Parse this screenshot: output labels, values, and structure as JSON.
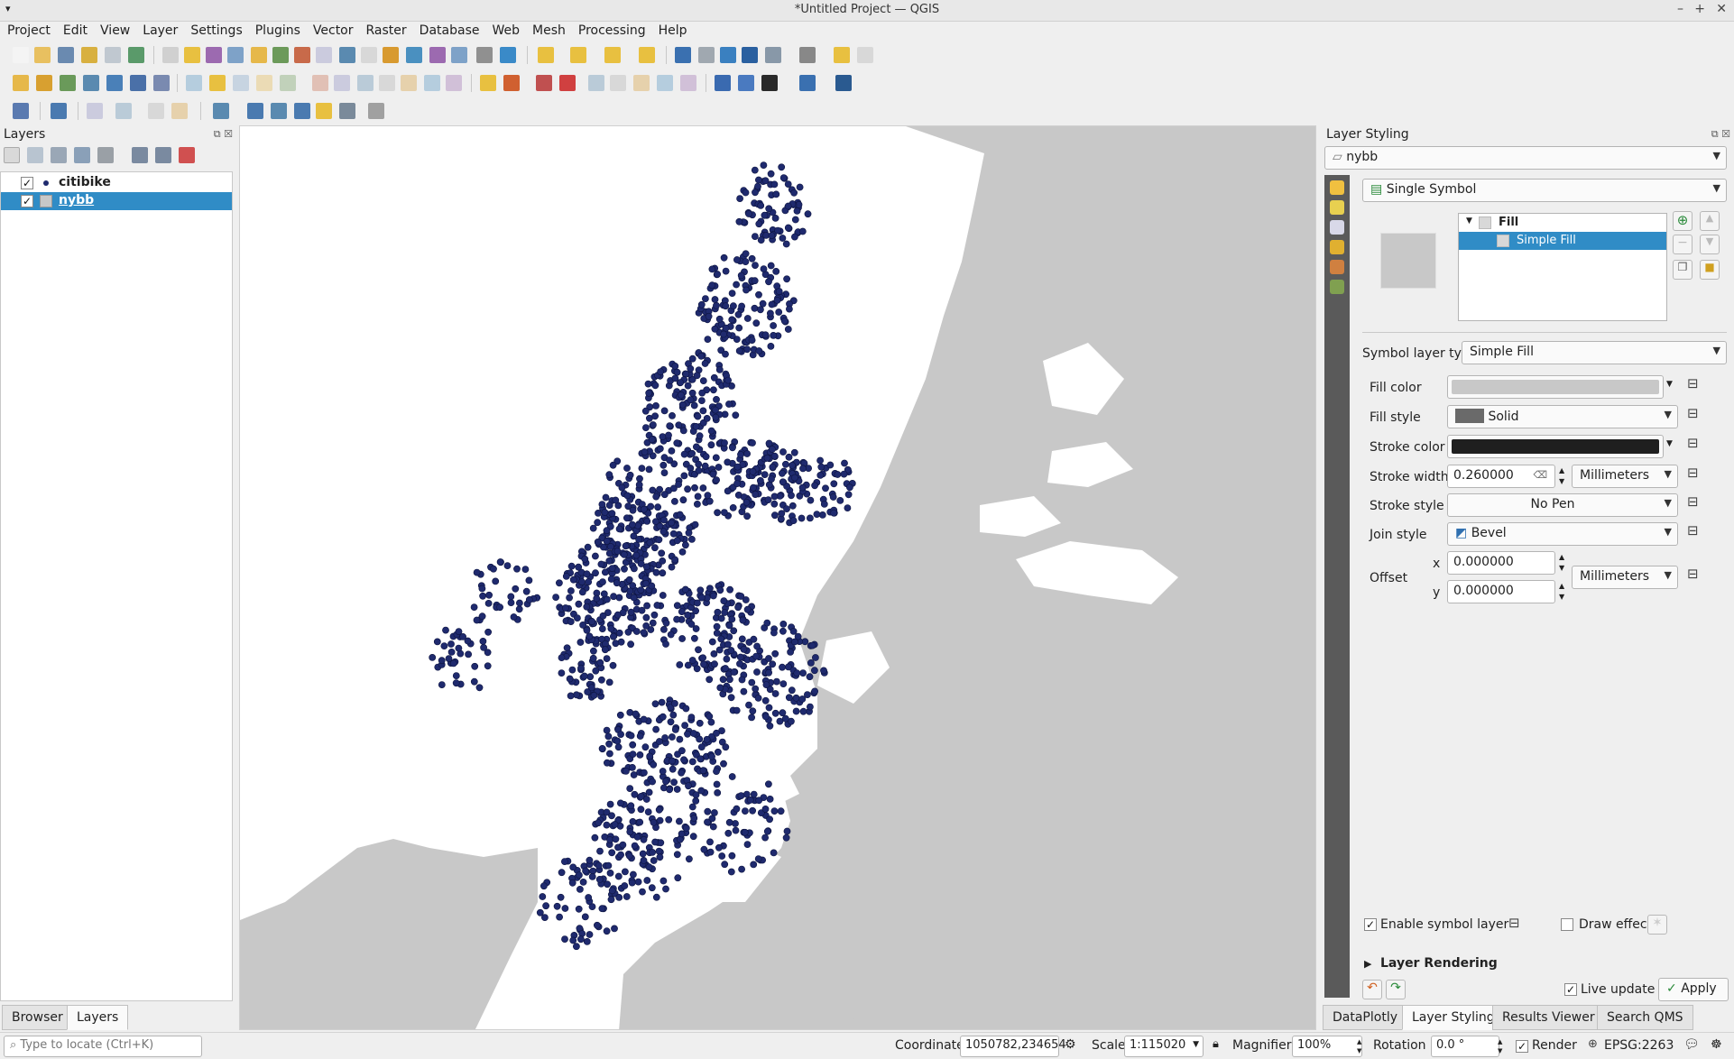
{
  "window": {
    "title": "*Untitled Project — QGIS"
  },
  "menu": [
    "Project",
    "Edit",
    "View",
    "Layer",
    "Settings",
    "Plugins",
    "Vector",
    "Raster",
    "Database",
    "Web",
    "Mesh",
    "Processing",
    "Help"
  ],
  "layers_panel": {
    "title": "Layers",
    "items": [
      {
        "name": "citibike",
        "checked": "✓",
        "selected": false
      },
      {
        "name": "nybb",
        "checked": "✓",
        "selected": true
      }
    ]
  },
  "left_tabs": [
    "Browser",
    "Layers"
  ],
  "styling": {
    "title": "Layer Styling",
    "layer": "nybb",
    "renderer": "Single Symbol",
    "tree": {
      "root": "Fill",
      "child": "Simple Fill"
    },
    "symbol_layer_type_label": "Symbol layer type",
    "symbol_layer_type": "Simple Fill",
    "fill_color_label": "Fill color",
    "fill_color": "#c8c8c8",
    "fill_style_label": "Fill style",
    "fill_style": "Solid",
    "stroke_color_label": "Stroke color",
    "stroke_color": "#1f1f1f",
    "stroke_width_label": "Stroke width",
    "stroke_width": "0.260000",
    "stroke_width_unit": "Millimeters",
    "stroke_style_label": "Stroke style",
    "stroke_style": "No Pen",
    "join_style_label": "Join style",
    "join_style": "Bevel",
    "offset_label": "Offset",
    "offset_x_label": "x",
    "offset_x": "0.000000",
    "offset_y_label": "y",
    "offset_y": "0.000000",
    "offset_unit": "Millimeters",
    "enable_symbol_layer": "Enable symbol layer",
    "draw_effects": "Draw effects",
    "layer_rendering": "Layer Rendering",
    "live_update": "Live update",
    "apply": "Apply"
  },
  "right_tabs": [
    "DataPlotly",
    "Layer Styling",
    "Results Viewer",
    "Search QMS"
  ],
  "status": {
    "locate_placeholder": "Type to locate (Ctrl+K)",
    "coordinate_label": "Coordinate",
    "coordinate": "1050782,234654",
    "scale_label": "Scale",
    "scale": "1:115020",
    "magnifier_label": "Magnifier",
    "magnifier": "100%",
    "rotation_label": "Rotation",
    "rotation": "0.0 °",
    "render": "Render",
    "crs": "EPSG:2263"
  },
  "map": {
    "land_color": "#c8c8c8",
    "point_color": "#1f2a6e"
  }
}
